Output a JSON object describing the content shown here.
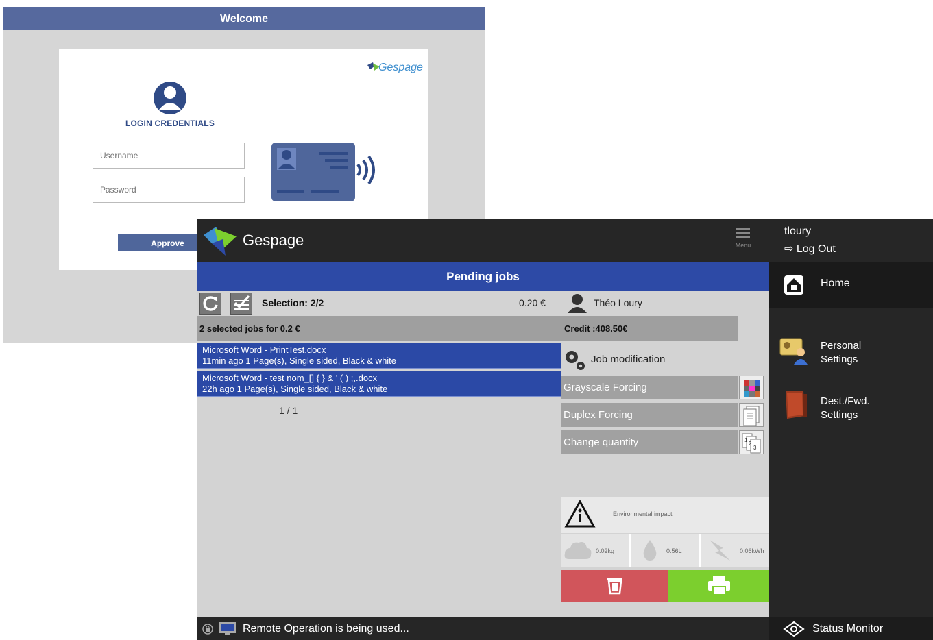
{
  "login": {
    "title": "Welcome",
    "brand": "Gespage",
    "credentials_label": "LOGIN CREDENTIALS",
    "username_placeholder": "Username",
    "password_placeholder": "Password",
    "approve_label": "Approve"
  },
  "app": {
    "name": "Gespage",
    "menu_label": "Menu",
    "section_title": "Pending jobs"
  },
  "toolbar": {
    "selection": "Selection: 2/2",
    "price": "0.20 €",
    "summary": "2 selected jobs for 0.2 €"
  },
  "jobs": [
    {
      "name": "Microsoft Word - PrintTest.docx",
      "details": "11min ago  1 Page(s), Single sided, Black & white"
    },
    {
      "name": "Microsoft Word - test nom_[] { } &   ' ( ) ;,.docx",
      "details": "22h ago  1 Page(s), Single sided, Black & white"
    }
  ],
  "pagination": "1 / 1",
  "user": {
    "full_name": "Théo Loury",
    "credit": "Credit :408.50€"
  },
  "job_modification": {
    "title": "Job modification",
    "grayscale": "Grayscale Forcing",
    "duplex": "Duplex Forcing",
    "quantity": "Change quantity"
  },
  "environment": {
    "title": "Environmental impact",
    "co2": "0.02kg",
    "water": "0.56L",
    "energy": "0.06kWh"
  },
  "side_panel": {
    "username": "tloury",
    "logout": "Log Out",
    "home": "Home",
    "personal_line1": "Personal",
    "personal_line2": "Settings",
    "dest_line1": "Dest./Fwd.",
    "dest_line2": "Settings",
    "status_monitor": "Status Monitor"
  },
  "status": {
    "message": "Remote Operation is being used..."
  },
  "colors": {
    "header_blue": "#2d4aa6",
    "login_blue": "#56699e",
    "delete_red": "#d1555b",
    "print_green": "#7ccf2e"
  }
}
